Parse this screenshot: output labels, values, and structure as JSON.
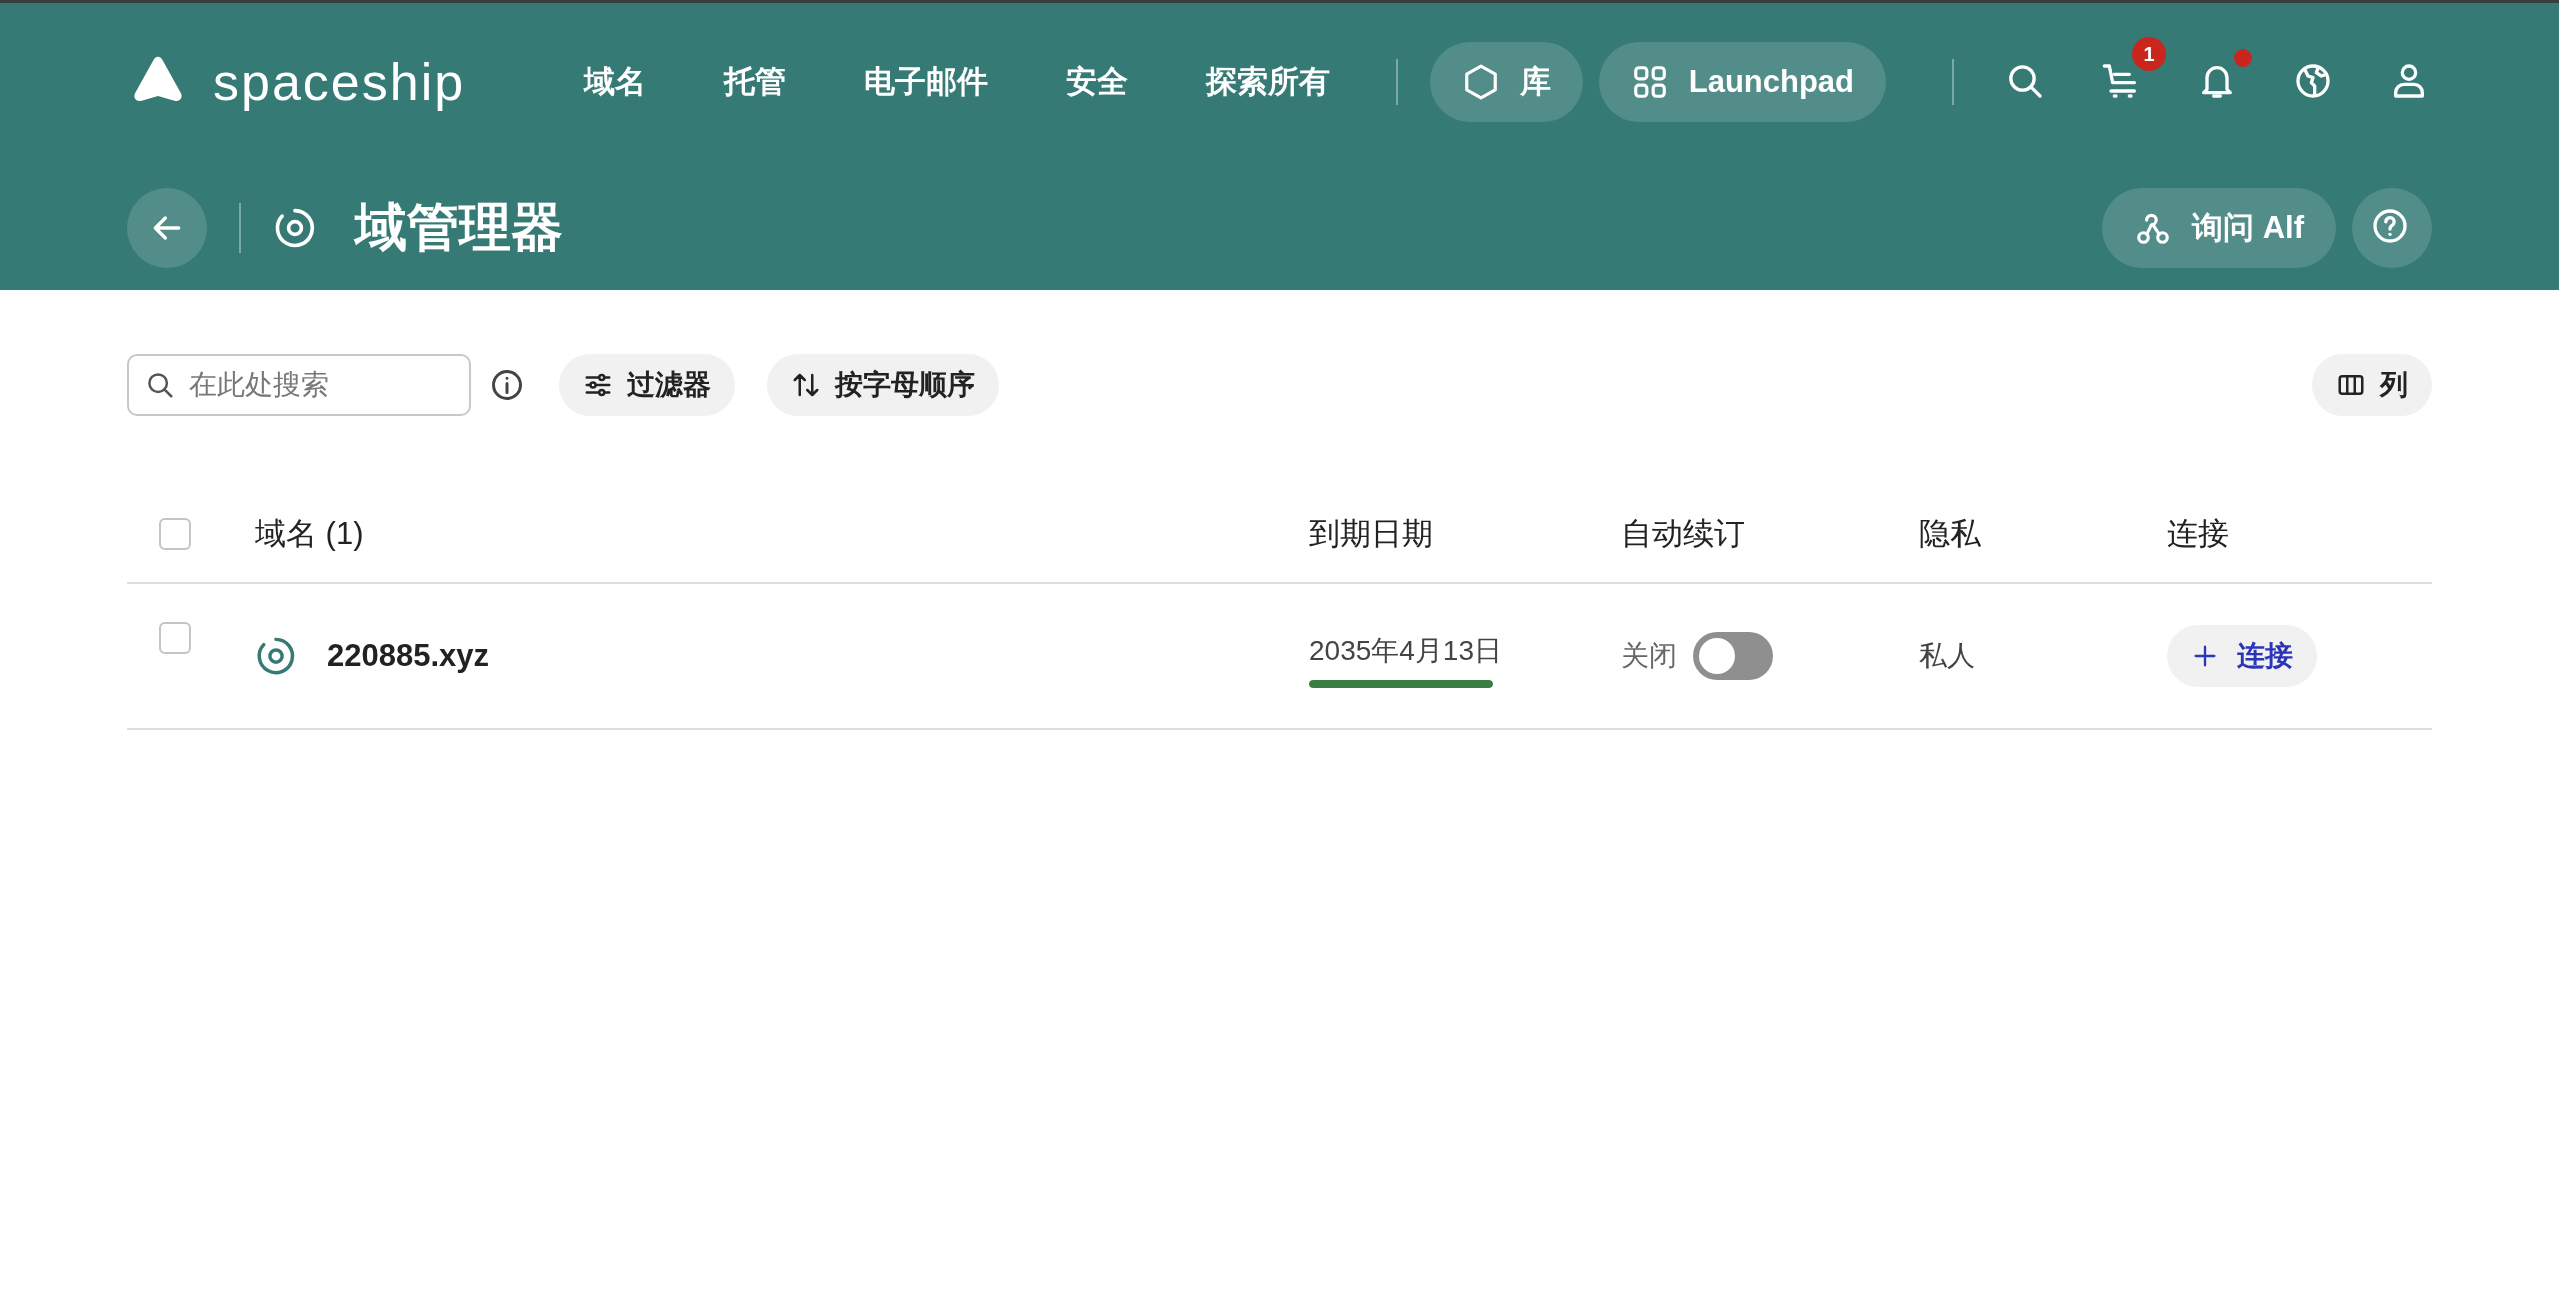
{
  "header": {
    "logo": "spaceship",
    "nav": [
      {
        "label": "域名"
      },
      {
        "label": "托管"
      },
      {
        "label": "电子邮件"
      },
      {
        "label": "安全"
      },
      {
        "label": "探索所有"
      }
    ],
    "pills": [
      {
        "kind": "library",
        "label": "库"
      },
      {
        "kind": "launchpad",
        "label": "Launchpad"
      }
    ],
    "icons": [
      {
        "kind": "search"
      },
      {
        "kind": "cart",
        "badge": "1"
      },
      {
        "kind": "bell",
        "dot": true
      },
      {
        "kind": "globe"
      },
      {
        "kind": "user"
      }
    ]
  },
  "page": {
    "title": "域管理器",
    "ask_button": "询问 Alf"
  },
  "toolbar": {
    "search": {
      "placeholder": "在此处搜索"
    },
    "filter": "过滤器",
    "sort": "按字母顺序",
    "columns": "列"
  },
  "table": {
    "select_all_checked": false,
    "columns": [
      {
        "label": "域名 (1)"
      },
      {
        "label": "到期日期"
      },
      {
        "label": "自动续订"
      },
      {
        "label": "隐私"
      },
      {
        "label": "连接"
      }
    ],
    "rows": [
      {
        "checked": false,
        "domain": "220885.xyz",
        "expiry": "2035年4月13日",
        "expiry_bar": {
          "level": 1
        },
        "auto_renew_label": "关闭",
        "auto_renew_on": false,
        "privacy": "私人",
        "connect": "连接"
      }
    ]
  }
}
